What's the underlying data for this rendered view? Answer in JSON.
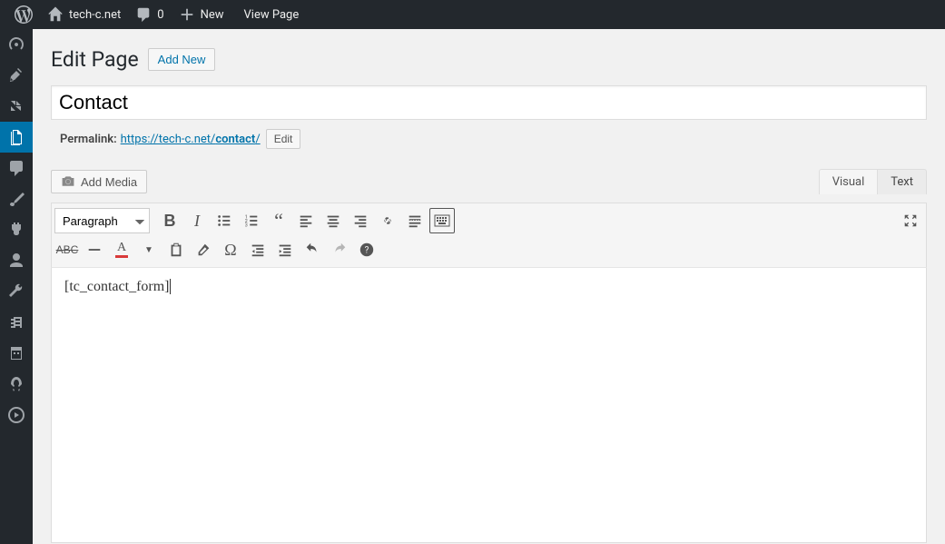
{
  "adminbar": {
    "site_name": "tech-c.net",
    "comments_count": "0",
    "new_label": "New",
    "view_page_label": "View Page"
  },
  "page": {
    "heading": "Edit Page",
    "add_new_label": "Add New",
    "title_value": "Contact",
    "permalink_label": "Permalink:",
    "permalink_base": "https://tech-c.net/",
    "permalink_slug": "contact",
    "permalink_trailing": "/",
    "permalink_edit_label": "Edit"
  },
  "editor": {
    "add_media_label": "Add Media",
    "tabs": {
      "visual": "Visual",
      "text": "Text"
    },
    "format_select": "Paragraph",
    "content": "[tc_contact_form]"
  },
  "toolbar": {
    "row1": [
      "bold",
      "italic",
      "ul",
      "ol",
      "quote",
      "align-left",
      "align-center",
      "align-right",
      "link",
      "more",
      "kitchen-sink"
    ],
    "row2": [
      "strike",
      "hr",
      "textcolor",
      "paste",
      "clear",
      "omega",
      "outdent",
      "indent",
      "undo",
      "redo",
      "help"
    ]
  }
}
